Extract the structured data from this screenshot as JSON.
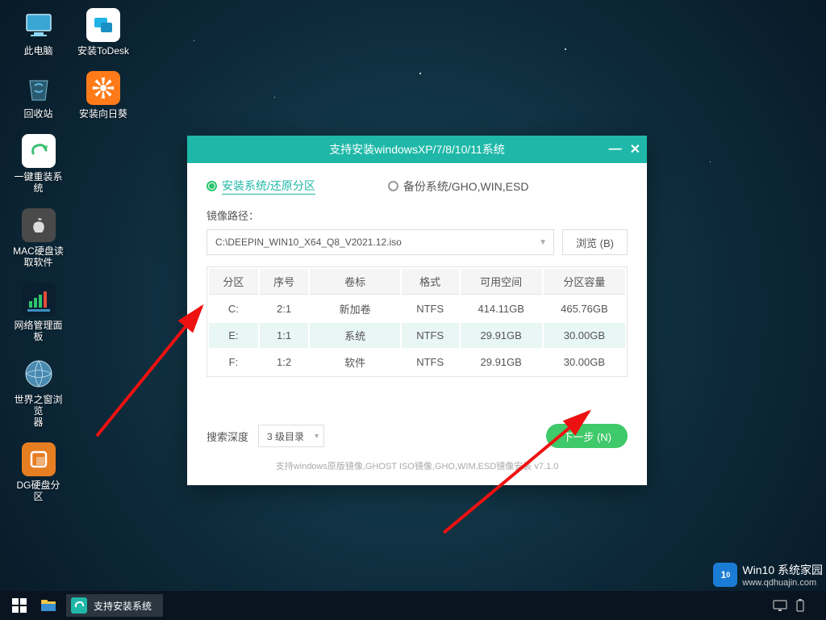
{
  "desktop": {
    "col1": [
      {
        "label": "此电脑"
      },
      {
        "label": "回收站"
      },
      {
        "label": "一键重装系统"
      },
      {
        "label": "MAC硬盘读\n取软件"
      },
      {
        "label": "网络管理面板"
      },
      {
        "label": "世界之窗浏览\n器"
      },
      {
        "label": "DG硬盘分区"
      }
    ],
    "col2": [
      {
        "label": "安装ToDesk"
      },
      {
        "label": "安装向日葵"
      }
    ]
  },
  "dialog": {
    "title": "支持安装windowsXP/7/8/10/11系统",
    "mode_install": "安装系统/还原分区",
    "mode_backup": "备份系统/GHO,WIN,ESD",
    "path_label": "镜像路径：",
    "path_value": "C:\\DEEPIN_WIN10_X64_Q8_V2021.12.iso",
    "browse": "浏览 (B)",
    "headers": {
      "part": "分区",
      "seq": "序号",
      "vol": "卷标",
      "fmt": "格式",
      "free": "可用空间",
      "cap": "分区容量"
    },
    "rows": [
      {
        "part": "C:",
        "seq": "2:1",
        "vol": "新加卷",
        "fmt": "NTFS",
        "free": "414.11GB",
        "cap": "465.76GB"
      },
      {
        "part": "E:",
        "seq": "1:1",
        "vol": "系统",
        "fmt": "NTFS",
        "free": "29.91GB",
        "cap": "30.00GB"
      },
      {
        "part": "F:",
        "seq": "1:2",
        "vol": "软件",
        "fmt": "NTFS",
        "free": "29.91GB",
        "cap": "30.00GB"
      }
    ],
    "depth_label": "搜索深度",
    "depth_value": "3 级目录",
    "next": "下一步 (N)",
    "footer": "支持windows原版镜像,GHOST ISO镜像,GHO,WIM,ESD镜像安装 v7.1.0"
  },
  "taskbar": {
    "active_task": "支持安装系统"
  },
  "watermark": {
    "brand": "Win10 系统家园",
    "url": "www.qdhuajin.com"
  }
}
